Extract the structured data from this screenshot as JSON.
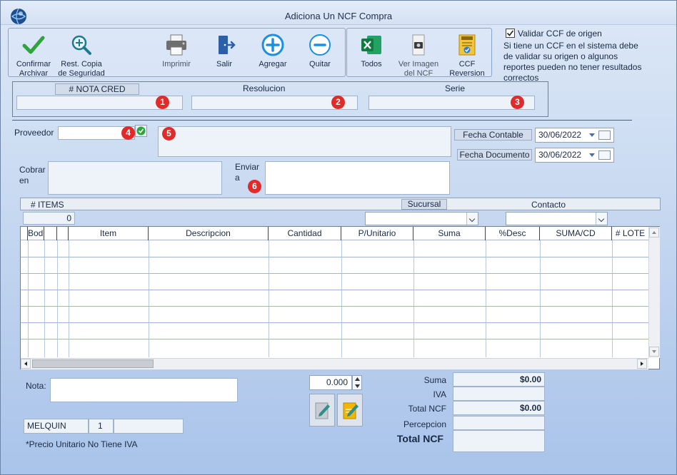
{
  "window": {
    "title": "Adiciona Un NCF Compra"
  },
  "toolbar": {
    "confirmar": "Confirmar\nArchivar",
    "restaurar": "Rest. Copia\nde Seguridad",
    "imprimir": "Imprimir",
    "salir": "Salir",
    "agregar": "Agregar",
    "quitar": "Quitar",
    "todos": "Todos",
    "ver_imagen": "Ver Imagen\ndel NCF",
    "ccf_reversion": "CCF\nReversion"
  },
  "validation": {
    "checkbox_label": "Validar CCF de origen",
    "checked": true,
    "note": "Si tiene un CCF en el sistema debe de validar su origen o algunos reportes pueden no tener resultados correctos"
  },
  "header_fields": {
    "nota_cred_label": "# NOTA CRED",
    "resolucion_label": "Resolucion",
    "serie_label": "Serie",
    "nota_cred_value": "",
    "resolucion_value": "",
    "serie_value": ""
  },
  "badges": [
    "1",
    "2",
    "3",
    "4",
    "5",
    "6"
  ],
  "proveedor": {
    "label": "Proveedor",
    "value": ""
  },
  "fechas": {
    "contable_label": "Fecha Contable",
    "contable_value": "30/06/2022",
    "documento_label": "Fecha Documento",
    "documento_value": "30/06/2022"
  },
  "cobrar": {
    "label_1": "Cobrar",
    "label_2": "en",
    "value": ""
  },
  "enviar": {
    "label_1": "Enviar",
    "label_2": "a",
    "value": ""
  },
  "items_bar": {
    "items_label": "# ITEMS",
    "items_count": "0",
    "sucursal_label": "Sucursal",
    "contacto_label": "Contacto",
    "sucursal_value": "",
    "contacto_value": ""
  },
  "grid": {
    "columns": [
      "Bodega",
      "",
      "Item",
      "Descripcion",
      "Cantidad",
      "P/Unitario",
      "Suma",
      "%Desc",
      "SUMA/CD",
      "# LOTE"
    ]
  },
  "nota": {
    "label": "Nota:",
    "value": ""
  },
  "quantity": {
    "value": "0.000"
  },
  "footer": {
    "user": "MELQUIN",
    "number": "1",
    "extra": "",
    "note": "*Precio Unitario No Tiene IVA"
  },
  "totals": {
    "suma_label": "Suma",
    "suma_value": "$0.00",
    "iva_label": "IVA",
    "iva_value": "",
    "total_ncf_label": "Total  NCF",
    "total_ncf_value": "$0.00",
    "percepcion_label": "Percepcion",
    "percepcion_value": "",
    "total_ncf_big_label": "Total  NCF",
    "total_ncf_big_value": ""
  },
  "colors": {
    "accent": "#2f6fd6",
    "badge": "#e02b2b",
    "window_bg": "#c9daf1"
  }
}
